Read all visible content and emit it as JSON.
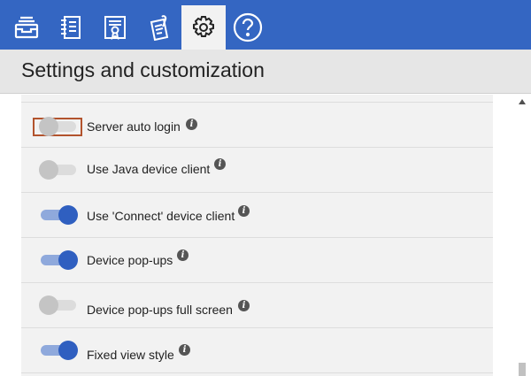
{
  "top_tabs": [
    {
      "icon": "inbox-tray-icon",
      "active": false
    },
    {
      "icon": "notebook-icon",
      "active": false
    },
    {
      "icon": "certificate-icon",
      "active": false
    },
    {
      "icon": "attachment-document-icon",
      "active": false
    },
    {
      "icon": "gear-icon",
      "active": true
    },
    {
      "icon": "help-icon",
      "active": false
    }
  ],
  "header": {
    "title": "Settings and customization"
  },
  "settings": [
    {
      "label": "Server auto login",
      "enabled": false,
      "focused": true,
      "info_icon": "info-icon"
    },
    {
      "label": "Use Java device client",
      "enabled": false,
      "info_icon": "info-icon"
    },
    {
      "label": "Use 'Connect' device client",
      "enabled": true,
      "info_icon": "info-icon"
    },
    {
      "label": "Device pop-ups",
      "enabled": true,
      "info_icon": "info-icon"
    },
    {
      "label": "Device pop-ups full screen",
      "enabled": false,
      "info_icon": "info-icon"
    },
    {
      "label": "Fixed view style",
      "enabled": true,
      "info_icon": "info-icon"
    }
  ],
  "colors": {
    "topbar": "#3466c2",
    "toggle_on_knob": "#2f5fc0",
    "toggle_on_track": "#8fa9dc",
    "toggle_off_knob": "#c4c4c4",
    "focus_ring": "#b2532d"
  }
}
